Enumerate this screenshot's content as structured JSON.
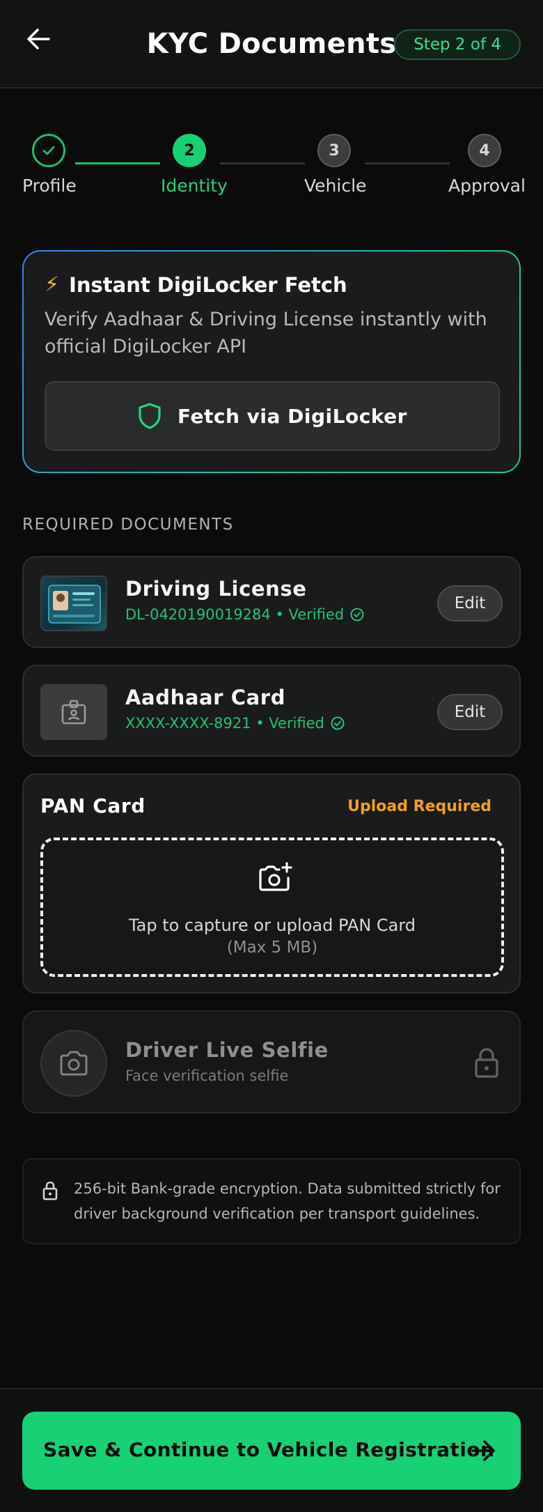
{
  "header": {
    "title": "KYC Documents",
    "step_badge": "Step 2 of 4"
  },
  "stepper": {
    "steps": [
      {
        "label": "Profile",
        "status": "done",
        "number": ""
      },
      {
        "label": "Identity",
        "status": "active",
        "number": "2"
      },
      {
        "label": "Vehicle",
        "status": "todo",
        "number": "3"
      },
      {
        "label": "Approval",
        "status": "todo",
        "number": "4"
      }
    ]
  },
  "digilocker": {
    "icon": "lightning-bolt-icon",
    "icon_glyph": "⚡",
    "title": "Instant DigiLocker Fetch",
    "description": "Verify Aadhaar & Driving License instantly with official DigiLocker API",
    "button_label": "Fetch via DigiLocker"
  },
  "documents_section": {
    "label": "REQUIRED DOCUMENTS"
  },
  "documents": [
    {
      "name": "Driving License",
      "subtitle": "DL-0420190019284 • Verified",
      "edit_label": "Edit",
      "status": "verified"
    },
    {
      "name": "Aadhaar Card",
      "subtitle": "XXXX-XXXX-8921 • Verified",
      "edit_label": "Edit",
      "status": "verified"
    }
  ],
  "pan": {
    "title": "PAN Card",
    "status": "Upload Required",
    "upload_text": "Tap to capture or upload PAN Card",
    "upload_limit": "(Max 5 MB)"
  },
  "selfie": {
    "title": "Driver Live Selfie",
    "subtitle": "Face verification selfie",
    "locked": true
  },
  "security_note": {
    "text": "256-bit Bank-grade encryption. Data submitted strictly for driver background verification per transport guidelines."
  },
  "footer": {
    "cta_label": "Save & Continue to Vehicle Registration"
  },
  "colors": {
    "accent": "#17d174",
    "warning": "#f0a020",
    "background": "#0b0b0b",
    "card": "#1a1b1c"
  }
}
